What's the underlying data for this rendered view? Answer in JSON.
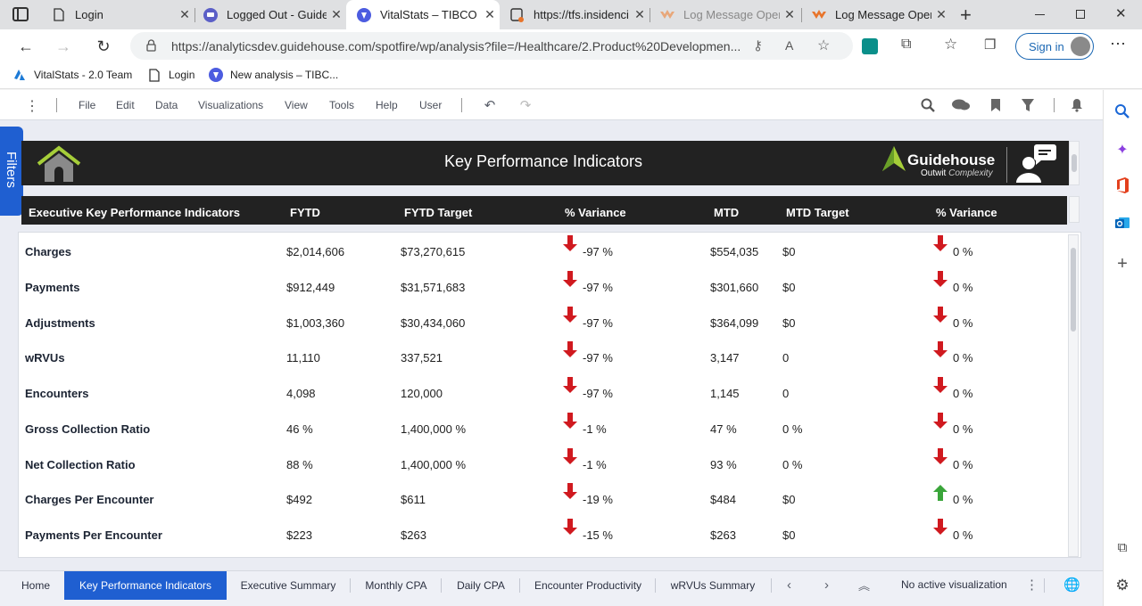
{
  "browser": {
    "tabs": [
      {
        "title": "Login",
        "icon": "page-icon"
      },
      {
        "title": "Logged Out - Guide",
        "icon": "chat-icon"
      },
      {
        "title": "VitalStats – TIBCO S",
        "icon": "tibco-icon",
        "active": true
      },
      {
        "title": "https://tfs.insidenci",
        "icon": "devops-icon"
      },
      {
        "title": "Log Message Opera",
        "icon": "postman-icon"
      },
      {
        "title": "Log Message Opera",
        "icon": "postman-icon"
      }
    ],
    "url": "https://analyticsdev.guidehouse.com/spotfire/wp/analysis?file=/Healthcare/2.Product%20Developmen...",
    "signin_label": "Sign in",
    "favorites": [
      {
        "label": "VitalStats - 2.0 Team",
        "icon": "azure-icon"
      },
      {
        "label": "Login",
        "icon": "page-icon"
      },
      {
        "label": "New analysis – TIBC...",
        "icon": "tibco-icon"
      }
    ]
  },
  "menu": [
    "File",
    "Edit",
    "Data",
    "Visualizations",
    "View",
    "Tools",
    "Help",
    "User"
  ],
  "filters_label": "Filters",
  "banner": {
    "title": "Key Performance Indicators",
    "logo_name": "Guidehouse",
    "logo_tag_a": "Outwit",
    "logo_tag_b": "Complexity"
  },
  "table": {
    "columns": [
      "Executive Key Performance Indicators",
      "FYTD",
      "FYTD Target",
      "% Variance",
      "MTD",
      "MTD Target",
      "% Variance"
    ],
    "rows": [
      {
        "label": "Charges",
        "fytd": "$2,014,606",
        "fytd_target": "$73,270,615",
        "var1": "-97 %",
        "dir1": "down",
        "mtd": "$554,035",
        "mtd_target": "$0",
        "var2": "0 %",
        "dir2": "down"
      },
      {
        "label": "Payments",
        "fytd": "$912,449",
        "fytd_target": "$31,571,683",
        "var1": "-97 %",
        "dir1": "down",
        "mtd": "$301,660",
        "mtd_target": "$0",
        "var2": "0 %",
        "dir2": "down"
      },
      {
        "label": "Adjustments",
        "fytd": "$1,003,360",
        "fytd_target": "$30,434,060",
        "var1": "-97 %",
        "dir1": "down",
        "mtd": "$364,099",
        "mtd_target": "$0",
        "var2": "0 %",
        "dir2": "down"
      },
      {
        "label": "wRVUs",
        "fytd": "11,110",
        "fytd_target": "337,521",
        "var1": "-97 %",
        "dir1": "down",
        "mtd": "3,147",
        "mtd_target": "0",
        "var2": "0 %",
        "dir2": "down"
      },
      {
        "label": "Encounters",
        "fytd": "4,098",
        "fytd_target": "120,000",
        "var1": "-97 %",
        "dir1": "down",
        "mtd": "1,145",
        "mtd_target": "0",
        "var2": "0 %",
        "dir2": "down"
      },
      {
        "label": "Gross Collection Ratio",
        "fytd": "46 %",
        "fytd_target": "1,400,000 %",
        "var1": "-1 %",
        "dir1": "down",
        "mtd": "47 %",
        "mtd_target": "0 %",
        "var2": "0 %",
        "dir2": "down"
      },
      {
        "label": "Net Collection Ratio",
        "fytd": "88 %",
        "fytd_target": "1,400,000 %",
        "var1": "-1 %",
        "dir1": "down",
        "mtd": "93 %",
        "mtd_target": "0 %",
        "var2": "0 %",
        "dir2": "down"
      },
      {
        "label": "Charges Per Encounter",
        "fytd": "$492",
        "fytd_target": "$611",
        "var1": "-19 %",
        "dir1": "down",
        "mtd": "$484",
        "mtd_target": "$0",
        "var2": "0 %",
        "dir2": "up"
      },
      {
        "label": "Payments Per Encounter",
        "fytd": "$223",
        "fytd_target": "$263",
        "var1": "-15 %",
        "dir1": "down",
        "mtd": "$263",
        "mtd_target": "$0",
        "var2": "0 %",
        "dir2": "down"
      }
    ]
  },
  "bottom_tabs": [
    "Home",
    "Key Performance Indicators",
    "Executive Summary",
    "Monthly CPA",
    "Daily CPA",
    "Encounter Productivity",
    "wRVUs Summary"
  ],
  "active_bottom_tab": "Key Performance Indicators",
  "status_text": "No active visualization",
  "colors": {
    "accent": "#1f5fd1",
    "down_arrow": "#d0191f",
    "up_arrow": "#3aa53a",
    "banner_bg": "#222222"
  }
}
